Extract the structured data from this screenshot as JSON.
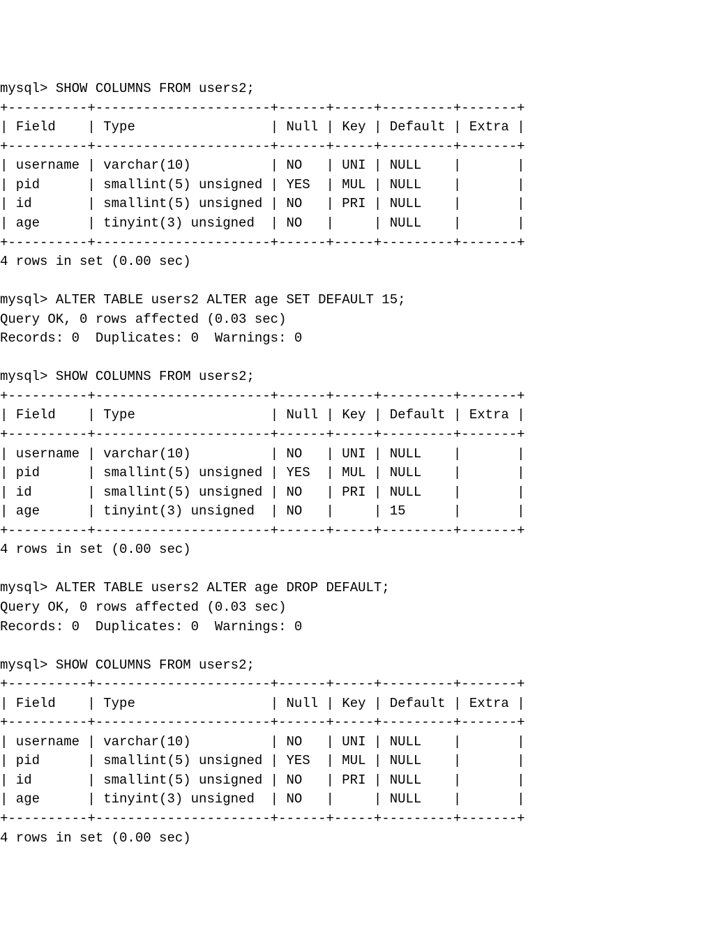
{
  "prompt": "mysql>",
  "commands": {
    "show_columns": "SHOW COLUMNS FROM users2;",
    "alter_set_default": "ALTER TABLE users2 ALTER age SET DEFAULT 15;",
    "alter_drop_default": "ALTER TABLE users2 ALTER age DROP DEFAULT;"
  },
  "responses": {
    "query_ok": "Query OK, 0 rows affected (0.03 sec)",
    "records_line": "Records: 0  Duplicates: 0  Warnings: 0",
    "rows_in_set": "4 rows in set (0.00 sec)"
  },
  "table_border": "+----------+----------------------+------+-----+---------+-------+",
  "headers": {
    "field": "Field",
    "type": "Type",
    "null": "Null",
    "key": "Key",
    "default": "Default",
    "extra": "Extra"
  },
  "table1": [
    {
      "field": "username",
      "type": "varchar(10)",
      "null": "NO",
      "key": "UNI",
      "default": "NULL",
      "extra": ""
    },
    {
      "field": "pid",
      "type": "smallint(5) unsigned",
      "null": "YES",
      "key": "MUL",
      "default": "NULL",
      "extra": ""
    },
    {
      "field": "id",
      "type": "smallint(5) unsigned",
      "null": "NO",
      "key": "PRI",
      "default": "NULL",
      "extra": ""
    },
    {
      "field": "age",
      "type": "tinyint(3) unsigned",
      "null": "NO",
      "key": "",
      "default": "NULL",
      "extra": ""
    }
  ],
  "table2": [
    {
      "field": "username",
      "type": "varchar(10)",
      "null": "NO",
      "key": "UNI",
      "default": "NULL",
      "extra": ""
    },
    {
      "field": "pid",
      "type": "smallint(5) unsigned",
      "null": "YES",
      "key": "MUL",
      "default": "NULL",
      "extra": ""
    },
    {
      "field": "id",
      "type": "smallint(5) unsigned",
      "null": "NO",
      "key": "PRI",
      "default": "NULL",
      "extra": ""
    },
    {
      "field": "age",
      "type": "tinyint(3) unsigned",
      "null": "NO",
      "key": "",
      "default": "15",
      "extra": ""
    }
  ],
  "table3": [
    {
      "field": "username",
      "type": "varchar(10)",
      "null": "NO",
      "key": "UNI",
      "default": "NULL",
      "extra": ""
    },
    {
      "field": "pid",
      "type": "smallint(5) unsigned",
      "null": "YES",
      "key": "MUL",
      "default": "NULL",
      "extra": ""
    },
    {
      "field": "id",
      "type": "smallint(5) unsigned",
      "null": "NO",
      "key": "PRI",
      "default": "NULL",
      "extra": ""
    },
    {
      "field": "age",
      "type": "tinyint(3) unsigned",
      "null": "NO",
      "key": "",
      "default": "NULL",
      "extra": ""
    }
  ]
}
